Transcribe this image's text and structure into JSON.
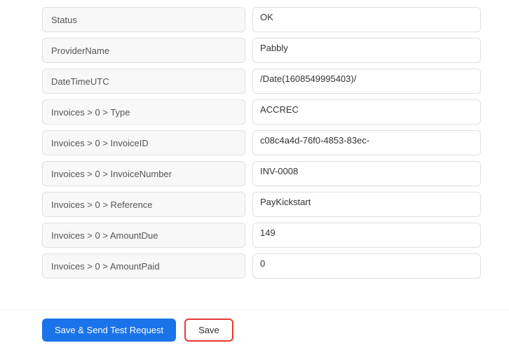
{
  "fields": [
    {
      "label": "Status",
      "value": "OK",
      "id": "status"
    },
    {
      "label": "ProviderName",
      "value": "Pabbly",
      "id": "provider-name"
    },
    {
      "label": "DateTimeUTC",
      "value": "/Date(1608549995403)/",
      "id": "date-time-utc"
    },
    {
      "label": "Invoices > 0 > Type",
      "value": "ACCREC",
      "id": "invoices-type"
    },
    {
      "label": "Invoices > 0 > InvoiceID",
      "value": "c08c4a4d-76f0-4853-83ec-",
      "id": "invoices-invoice-id"
    },
    {
      "label": "Invoices > 0 > InvoiceNumber",
      "value": "INV-0008",
      "id": "invoices-invoice-number"
    },
    {
      "label": "Invoices > 0 > Reference",
      "value": "PayKickstart",
      "id": "invoices-reference"
    },
    {
      "label": "Invoices > 0 > AmountDue",
      "value": "149",
      "id": "invoices-amount-due"
    },
    {
      "label": "Invoices > 0 > AmountPaid",
      "value": "0",
      "id": "invoices-amount-paid"
    }
  ],
  "footer": {
    "save_send_label": "Save & Send Test Request",
    "save_label": "Save"
  }
}
